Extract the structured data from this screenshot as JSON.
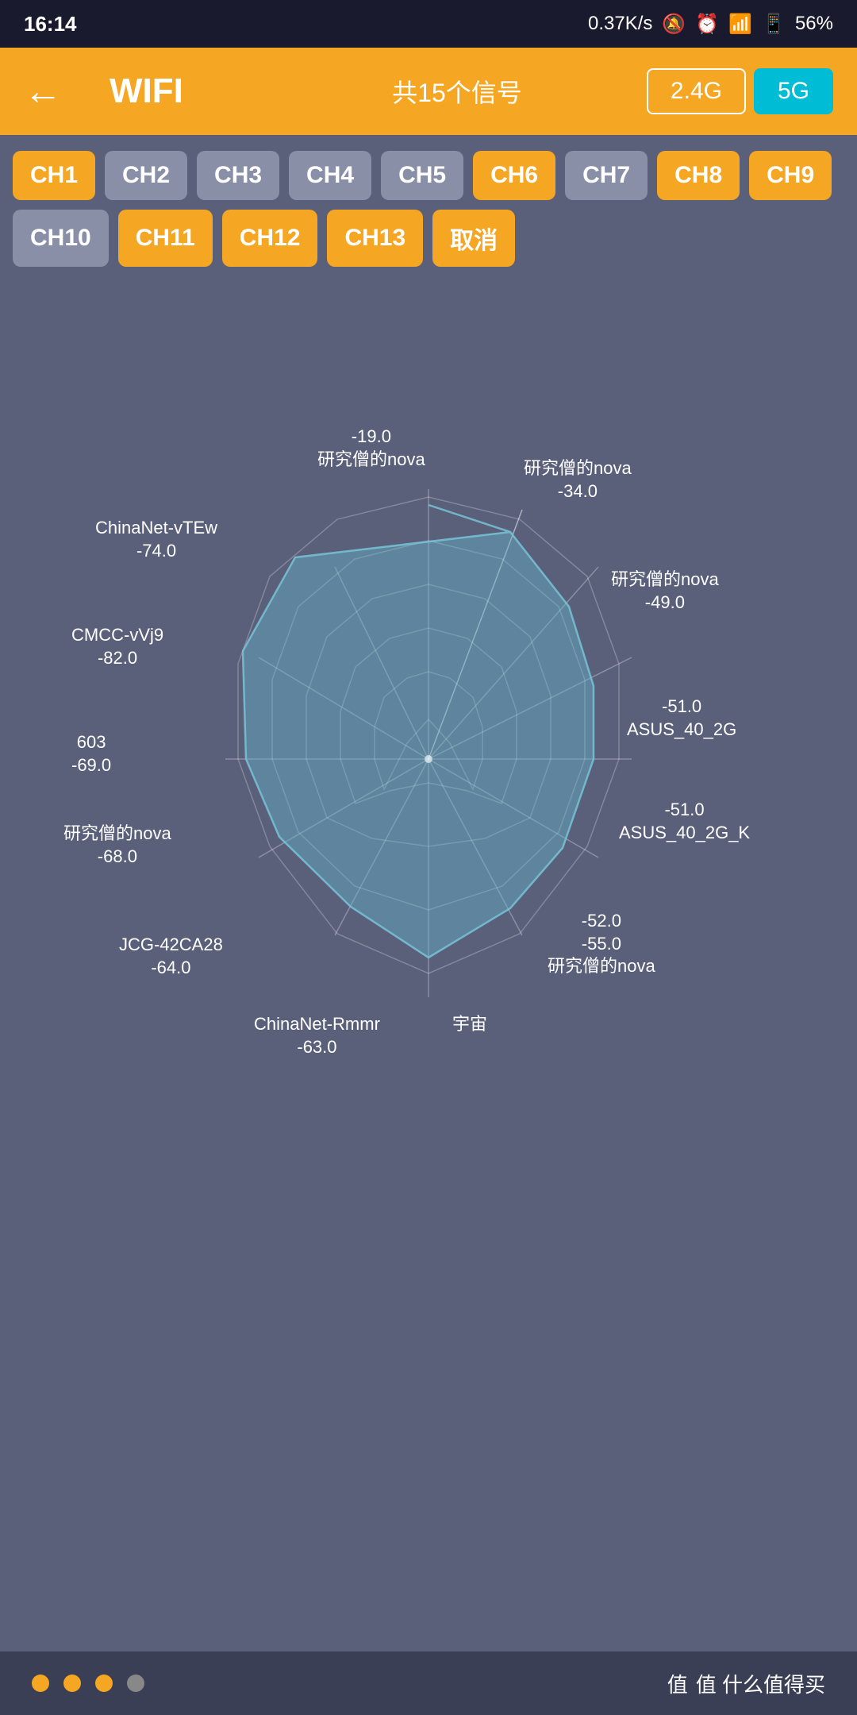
{
  "statusBar": {
    "time": "16:14",
    "speed": "0.37K/s",
    "battery": "56%"
  },
  "header": {
    "title": "WIFI",
    "count": "共15个信号",
    "freq_2_4": "2.4G",
    "freq_5": "5G",
    "back_label": "←"
  },
  "channels": [
    {
      "id": "CH1",
      "state": "active"
    },
    {
      "id": "CH2",
      "state": "inactive"
    },
    {
      "id": "CH3",
      "state": "inactive"
    },
    {
      "id": "CH4",
      "state": "inactive"
    },
    {
      "id": "CH5",
      "state": "inactive"
    },
    {
      "id": "CH6",
      "state": "active"
    },
    {
      "id": "CH7",
      "state": "inactive"
    },
    {
      "id": "CH8",
      "state": "active"
    },
    {
      "id": "CH9",
      "state": "active"
    },
    {
      "id": "CH10",
      "state": "inactive"
    },
    {
      "id": "CH11",
      "state": "active"
    },
    {
      "id": "CH12",
      "state": "active"
    },
    {
      "id": "CH13",
      "state": "active"
    },
    {
      "id": "取消",
      "state": "cancel"
    }
  ],
  "radar": {
    "networkLabels": [
      {
        "name": "研究僧的nova",
        "value": "-19.0",
        "position": "top"
      },
      {
        "name": "研究僧的nova",
        "value": "-34.0",
        "position": "top-right"
      },
      {
        "name": "研究僧的nova",
        "value": "-49.0",
        "position": "right-upper"
      },
      {
        "name": "ASUS_40_2G",
        "value": "-51.0",
        "position": "right"
      },
      {
        "name": "ASUS_40_2G_K",
        "value": "-51.0",
        "position": "right-lower"
      },
      {
        "name": "研究僧的nova",
        "value": "-55.0",
        "position": "bottom-right"
      },
      {
        "name": "宇宙",
        "value": "",
        "position": "bottom-center-right"
      },
      {
        "name": "ChinaNet-Rmmr",
        "value": "",
        "position": "bottom-center"
      },
      {
        "name": "JCG-42CA28",
        "value": "-63.0",
        "position": "bottom-left"
      },
      {
        "name": "研究僧的nova",
        "value": "-64.0",
        "position": "left-lower"
      },
      {
        "name": "603",
        "value": "-68.0",
        "position": "left-mid"
      },
      {
        "name": "CMCC-vVj9",
        "value": "-69.0",
        "position": "left"
      },
      {
        "name": "ChinaNet-vTEw",
        "value": "-74.0",
        "position": "left-upper"
      },
      {
        "name": "",
        "value": "-82.0",
        "position": "top-left"
      },
      {
        "name": "",
        "value": "-52.0",
        "position": "bottom-right-inner"
      }
    ],
    "accentColor": "#7ab8c8"
  },
  "bottomBar": {
    "dots": [
      "yellow",
      "yellow",
      "yellow",
      "gray"
    ],
    "brand": "值 什么值得买"
  }
}
